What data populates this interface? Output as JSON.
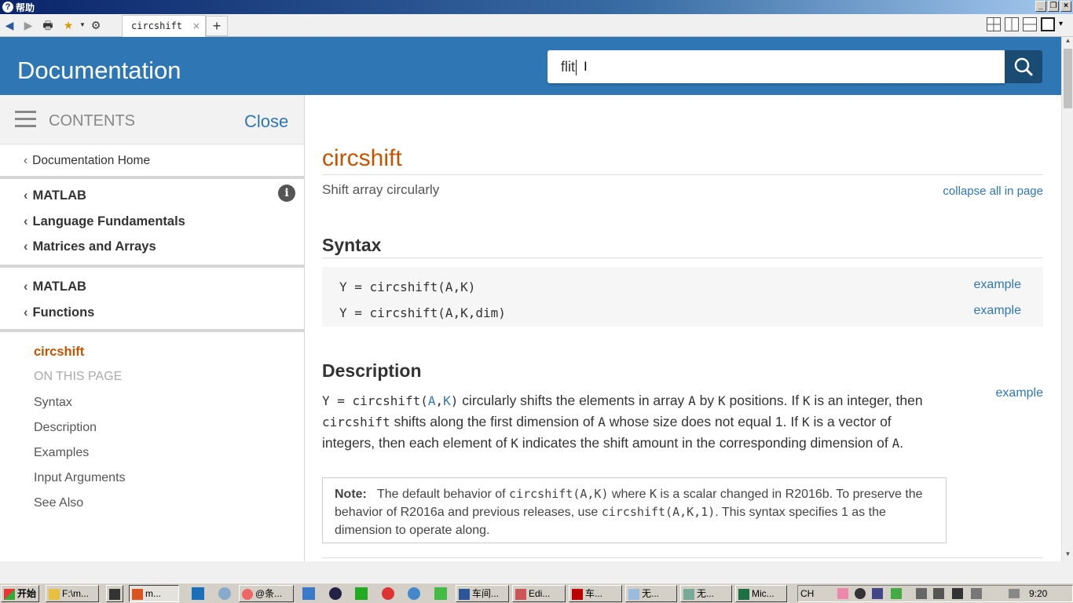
{
  "window": {
    "title": "帮助",
    "min": "_",
    "restore": "❐",
    "close": "×"
  },
  "browser": {
    "tab_label": "circshift",
    "tab_close": "×",
    "new_tab": "+"
  },
  "header": {
    "title": "Documentation",
    "search_value": "flit"
  },
  "sidebar": {
    "contents_label": "CONTENTS",
    "close_label": "Close",
    "home": "Documentation Home",
    "crumbs_1": [
      "MATLAB",
      "Language Fundamentals",
      "Matrices and Arrays"
    ],
    "crumbs_2": [
      "MATLAB",
      "Functions"
    ],
    "current": "circshift",
    "on_this_page": "ON THIS PAGE",
    "sections": [
      "Syntax",
      "Description",
      "Examples",
      "Input Arguments",
      "See Also"
    ]
  },
  "main": {
    "title": "circshift",
    "purpose": "Shift array circularly",
    "collapse_all": "collapse all in page",
    "syntax_heading": "Syntax",
    "syntax": [
      {
        "code": "Y = circshift(A,K)",
        "link": "example"
      },
      {
        "code": "Y = circshift(A,K,dim)",
        "link": "example"
      }
    ],
    "description_heading": "Description",
    "desc_example": "example",
    "desc": {
      "c1": "Y = circshift(",
      "a": "A",
      "comma": ",",
      "k": "K",
      "c2": ")",
      "t1": " circularly shifts the elements in array ",
      "A1": "A",
      "t2": " by ",
      "K1": "K",
      "t3": " positions. If ",
      "K2": "K",
      "t4": " is an integer, then ",
      "fn": "circshift",
      "t5": " shifts along the first dimension of ",
      "A2": "A",
      "t6": " whose size does not equal 1. If ",
      "K3": "K",
      "t7": " is a vector of integers, then each element of ",
      "K4": "K",
      "t8": " indicates the shift amount in the corresponding dimension of ",
      "A3": "A",
      "t9": "."
    },
    "note": {
      "label": "Note:",
      "t1": "The default behavior of ",
      "c1": "circshift(A,K)",
      "t2": " where ",
      "k": "K",
      "t3": " is a scalar changed in R2016b. To preserve the behavior of R2016a and previous releases, use ",
      "c2": "circshift(A,K,1)",
      "t4": ". This syntax specifies 1 as the dimension to operate along."
    }
  },
  "taskbar": {
    "start": "开始",
    "buttons": [
      "F:\\m...",
      "m...",
      "@条...",
      "车间...",
      "Edi...",
      "车...",
      "无...",
      "无...",
      "Mic..."
    ],
    "lang": "CH",
    "clock": "9:20"
  },
  "colors": {
    "header_blue": "#2f77b4",
    "title_orange": "#c45400",
    "search_btn": "#1a4b72"
  }
}
